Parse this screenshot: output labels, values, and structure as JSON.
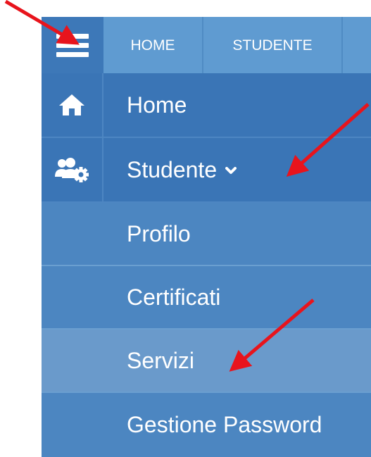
{
  "top_tabs": {
    "home": "HOME",
    "studente": "STUDENTE"
  },
  "menu": {
    "home": "Home",
    "studente": "Studente",
    "items": [
      "Profilo",
      "Certificati",
      "Servizi",
      "Gestione Password"
    ],
    "active_item": "Servizi"
  },
  "icons": {
    "hamburger": "menu-icon",
    "home": "home-icon",
    "studente": "users-gear-icon",
    "chevron": "chevron-down-icon"
  },
  "colors": {
    "dark_blue": "#3a75b6",
    "light_blue": "#5f9bd1",
    "sub_blue": "#4c86c1",
    "active_blue": "#6a9acb",
    "annotation_red": "#e8141c"
  }
}
